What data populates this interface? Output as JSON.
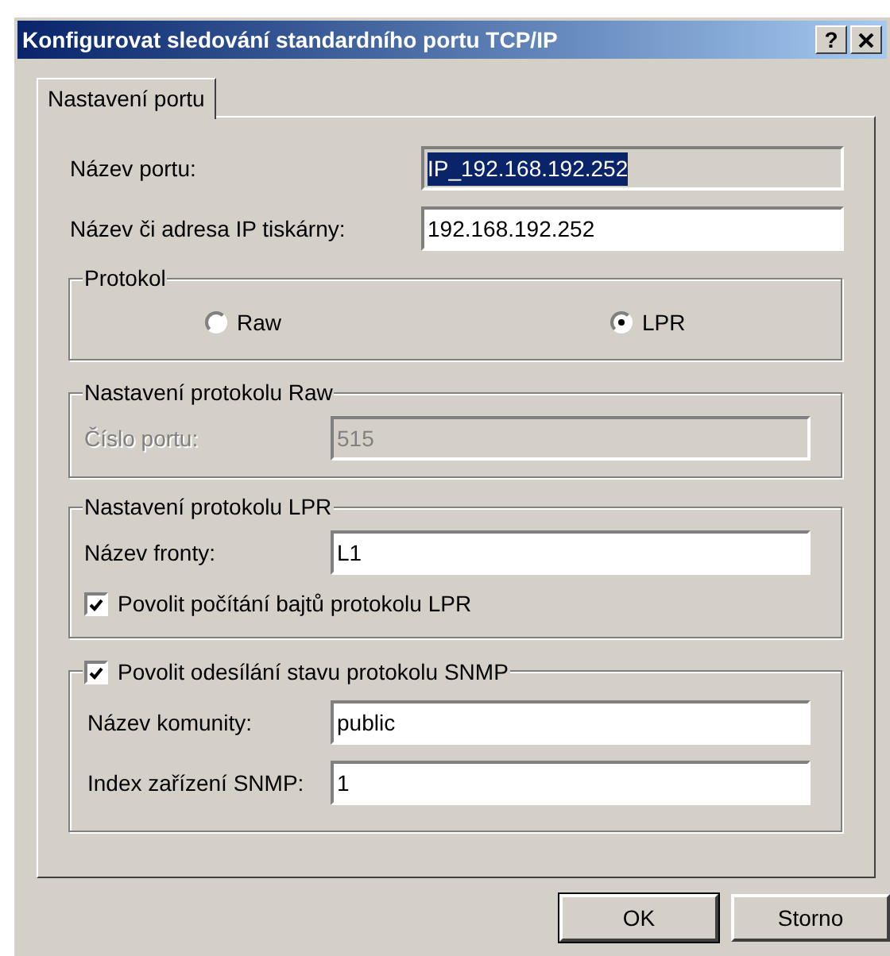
{
  "window": {
    "title": "Konfigurovat sledování standardního portu TCP/IP",
    "help_button": "?"
  },
  "tabs": [
    {
      "label": "Nastavení portu",
      "selected": true
    }
  ],
  "fields": [
    {
      "label": "Název portu:",
      "value": "IP_192.168.192.252",
      "read_only": true,
      "text_selected": true
    },
    {
      "label": "Název či adresa IP tiskárny:",
      "value": "192.168.192.252",
      "read_only": false,
      "text_selected": false
    }
  ],
  "protocol": {
    "title": "Protokol",
    "options": [
      {
        "label": "Raw",
        "selected": false
      },
      {
        "label": "LPR",
        "selected": true
      }
    ]
  },
  "raw_settings": {
    "title": "Nastavení protokolu Raw",
    "disabled": true,
    "fields": [
      {
        "label": "Číslo portu:",
        "value": "515"
      }
    ]
  },
  "lpr_settings": {
    "title": "Nastavení protokolu LPR",
    "disabled": false,
    "fields": [
      {
        "label": "Název fronty:",
        "value": "L1"
      }
    ],
    "checkbox": {
      "label": "Povolit počítání bajtů protokolu LPR",
      "checked": true
    }
  },
  "snmp_settings": {
    "checkbox": {
      "label": "Povolit odesílání stavu protokolu SNMP",
      "checked": true
    },
    "fields": [
      {
        "label": "Název komunity:",
        "value": "public"
      },
      {
        "label": "Index zařízení SNMP:",
        "value": "1"
      }
    ]
  },
  "buttons": [
    {
      "label": "OK",
      "default": true
    },
    {
      "label": "Storno",
      "default": false
    }
  ]
}
